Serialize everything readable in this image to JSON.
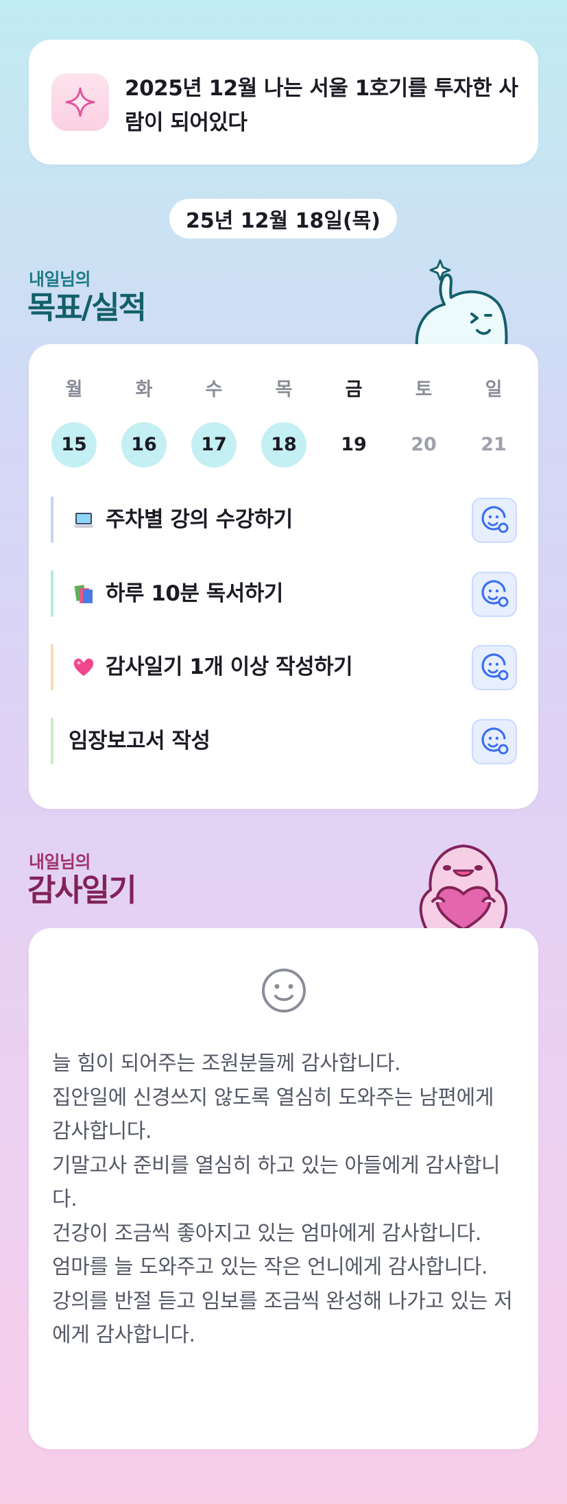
{
  "goal_header": {
    "icon": "sparkle-icon",
    "text": "2025년 12월 나는 서울 1호기를 투자한 사람이 되어있다"
  },
  "date_pill": "25년 12월 18일(목)",
  "goals_section": {
    "subtitle": "내일님의",
    "title": "목표/실적",
    "mascot": "waving-ghost-mascot"
  },
  "week": {
    "days": [
      {
        "dow": "월",
        "num": "15",
        "state": "done"
      },
      {
        "dow": "화",
        "num": "16",
        "state": "done"
      },
      {
        "dow": "수",
        "num": "17",
        "state": "done"
      },
      {
        "dow": "목",
        "num": "18",
        "state": "done"
      },
      {
        "dow": "금",
        "num": "19",
        "state": "today"
      },
      {
        "dow": "토",
        "num": "20",
        "state": "future"
      },
      {
        "dow": "일",
        "num": "21",
        "state": "future"
      }
    ]
  },
  "goals": [
    {
      "icon": "laptop-icon",
      "label": "주차별 강의 수강하기",
      "bar_color": "#c9d3f5"
    },
    {
      "icon": "books-icon",
      "label": "하루 10분 독서하기",
      "bar_color": "#b4ecd6"
    },
    {
      "icon": "heart-icon",
      "label": "감사일기 1개 이상 작성하기",
      "bar_color": "#f6dcb6"
    },
    {
      "icon": "",
      "label": "임장보고서 작성",
      "bar_color": "#c9eec3"
    }
  ],
  "gratitude_section": {
    "subtitle": "내일님의",
    "title": "감사일기",
    "mascot": "heart-hugging-mascot"
  },
  "gratitude": {
    "mood_icon": "smile-icon",
    "lines": [
      "늘 힘이 되어주는 조원분들께 감사합니다.",
      "집안일에 신경쓰지 않도록 열심히 도와주는 남편에게 감사합니다.",
      "기말고사 준비를 열심히 하고 있는 아들에게 감사합니다.",
      "건강이 조금씩 좋아지고 있는 엄마에게 감사합니다.",
      "엄마를 늘 도와주고 있는 작은 언니에게 감사합니다.",
      "강의를 반절 듣고 임보를 조금씩 완성해 나가고 있는 저에게 감사합니다."
    ]
  },
  "colors": {
    "accent_teal": "#135f6a",
    "accent_magenta": "#812259",
    "done_day": "#c4eff3",
    "face_button": "#e7efff"
  }
}
